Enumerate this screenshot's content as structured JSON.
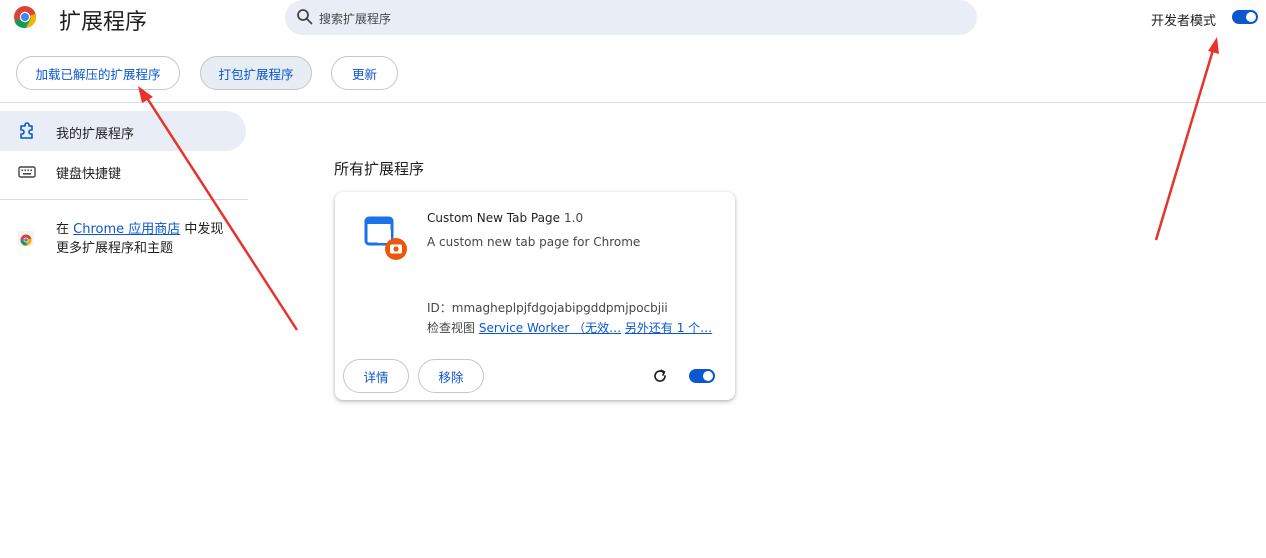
{
  "header": {
    "title": "扩展程序",
    "search_placeholder": "搜索扩展程序",
    "devmode_label": "开发者模式",
    "devmode_enabled": true
  },
  "toolbar": {
    "load_unpacked": "加载已解压的扩展程序",
    "pack": "打包扩展程序",
    "update": "更新"
  },
  "sidebar": {
    "items": [
      {
        "label": "我的扩展程序",
        "icon": "puzzle-icon",
        "active": true
      },
      {
        "label": "键盘快捷键",
        "icon": "keyboard-icon",
        "active": false
      }
    ],
    "store_prefix": "在 ",
    "store_link": "Chrome 应用商店",
    "store_suffix": " 中发现更多扩展程序和主题"
  },
  "main": {
    "section_title": "所有扩展程序",
    "extension": {
      "name": "Custom New Tab Page",
      "version": "1.0",
      "description": "A custom new tab page for Chrome",
      "id_label": "ID：",
      "id": "mmagheplpjfdgojabipgddpmjpocbjii",
      "inspect_label": "检查视图 ",
      "inspect_link1": "Service Worker （无效…",
      "inspect_link2": "另外还有 1 个…",
      "details_button": "详情",
      "remove_button": "移除",
      "enabled": true
    }
  },
  "colors": {
    "accent": "#0b57d0",
    "annotation_arrow": "#e8322b"
  }
}
